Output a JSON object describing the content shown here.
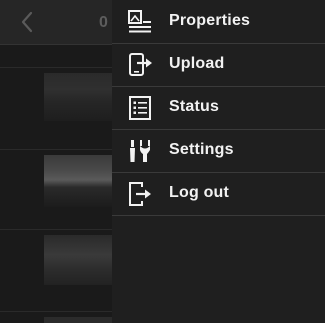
{
  "header": {
    "title_fragment": "0"
  },
  "menu": {
    "items": [
      {
        "label": "Properties",
        "icon": "properties-icon"
      },
      {
        "label": "Upload",
        "icon": "upload-icon"
      },
      {
        "label": "Status",
        "icon": "status-list-icon"
      },
      {
        "label": "Settings",
        "icon": "settings-tools-icon"
      },
      {
        "label": "Log out",
        "icon": "logout-icon"
      }
    ]
  },
  "colors": {
    "background": "#1a1a1a",
    "menu_background": "#1f1f1f",
    "menu_text": "#f2f2f2",
    "divider": "#3a3a3a"
  }
}
